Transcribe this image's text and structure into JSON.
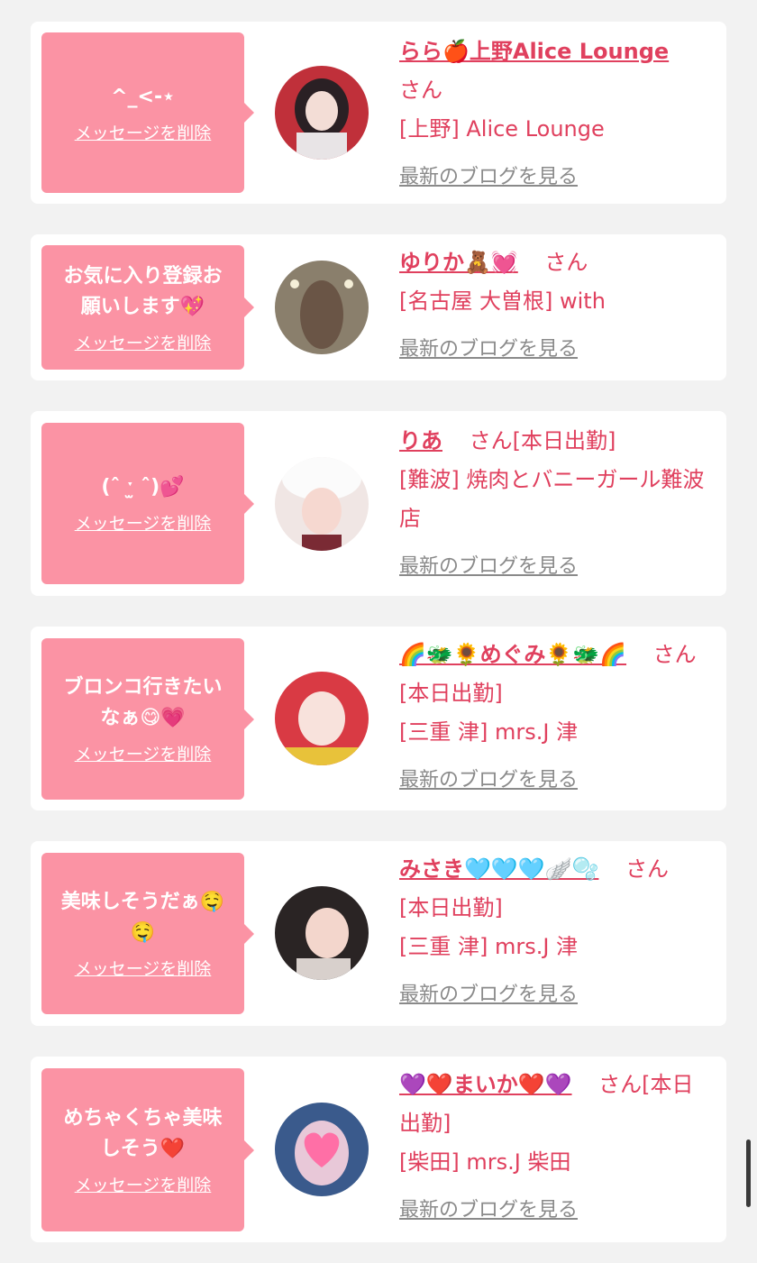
{
  "common": {
    "delete_label": "メッセージを削除",
    "blog_label": "最新のブログを見る",
    "san": "さん"
  },
  "items": [
    {
      "message": "^_<-⋆",
      "name": "らら🍎上野Alice Lounge",
      "status": "",
      "shop": "[上野] Alice Lounge"
    },
    {
      "message": "お気に入り登録お\n願いします💖",
      "name": "ゆりか🧸💓",
      "status": "",
      "shop": "[名古屋 大曽根] with"
    },
    {
      "message": "(ˆ ˑ̫ ˆ)💕",
      "name": "りあ",
      "status": "[本日出勤]",
      "shop": "[難波] 焼肉とバニーガール難波店"
    },
    {
      "message": "ブロンコ行きたい\nなぁ😋💗",
      "name": "🌈🐲🌻めぐみ🌻🐲🌈",
      "status": "[本日出勤]",
      "shop": "[三重 津] mrs.J 津"
    },
    {
      "message": "美味しそうだぁ🤤\n🤤",
      "name": "みさき🩵🩵🩵🪽🫧",
      "status": "[本日出勤]",
      "shop": "[三重 津] mrs.J 津"
    },
    {
      "message": "めちゃくちゃ美味\nしそう❤️",
      "name": "💜❤️まいか❤️💜",
      "status": "[本日出勤]",
      "shop": "[柴田] mrs.J 柴田"
    }
  ],
  "colors": {
    "bubble": "#fb93a4",
    "accent": "#e0405e",
    "background": "#f2f2f2"
  }
}
